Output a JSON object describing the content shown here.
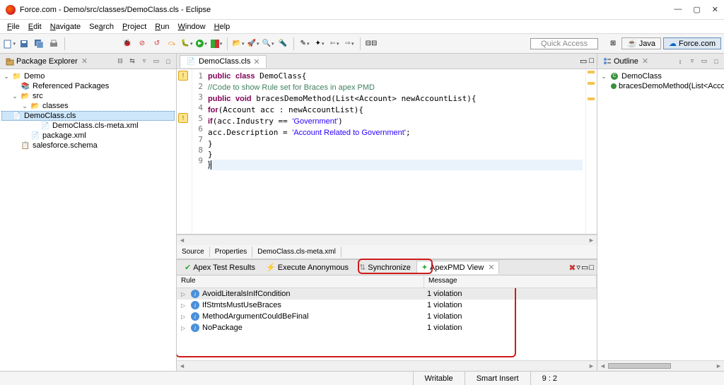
{
  "window": {
    "title": "Force.com - Demo/src/classes/DemoClass.cls - Eclipse"
  },
  "menu": [
    "File",
    "Edit",
    "Navigate",
    "Search",
    "Project",
    "Run",
    "Window",
    "Help"
  ],
  "quick_access": "Quick Access",
  "perspectives": [
    {
      "label": "Java",
      "active": false
    },
    {
      "label": "Force.com",
      "active": true
    }
  ],
  "pkg_explorer": {
    "title": "Package Explorer",
    "tree": {
      "root": "Demo",
      "ref_pkgs": "Referenced Packages",
      "src": "src",
      "classes": "classes",
      "file1": "DemoClass.cls",
      "file2": "DemoClass.cls-meta.xml",
      "pkgxml": "package.xml",
      "schema": "salesforce.schema"
    }
  },
  "editor": {
    "tab": "DemoClass.cls",
    "lines": [
      "public class DemoClass{",
      "//Code to show Rule set for Braces in apex PMD",
      "public void bracesDemoMethod(List<Account> newAccountList){",
      "for(Account acc : newAccountList){",
      "if(acc.Industry == 'Government')",
      "acc.Description = 'Account Related to Government';",
      "}",
      "}",
      "}"
    ],
    "src_tabs": [
      "Source",
      "Properties",
      "DemoClass.cls-meta.xml"
    ]
  },
  "bottom": {
    "tabs": [
      "Apex Test Results",
      "Execute Anonymous",
      "Synchronize",
      "ApexPMD View"
    ],
    "active": 3,
    "columns": {
      "rule": "Rule",
      "message": "Message"
    },
    "rows": [
      {
        "rule": "AvoidLiteralsInIfCondition",
        "msg": "1 violation"
      },
      {
        "rule": "IfStmtsMustUseBraces",
        "msg": "1 violation"
      },
      {
        "rule": "MethodArgumentCouldBeFinal",
        "msg": "1 violation"
      },
      {
        "rule": "NoPackage",
        "msg": "1 violation"
      }
    ]
  },
  "outline": {
    "title": "Outline",
    "root": "DemoClass",
    "method": "bracesDemoMethod(List<Accou"
  },
  "status": {
    "writable": "Writable",
    "insert": "Smart Insert",
    "pos": "9 : 2"
  }
}
